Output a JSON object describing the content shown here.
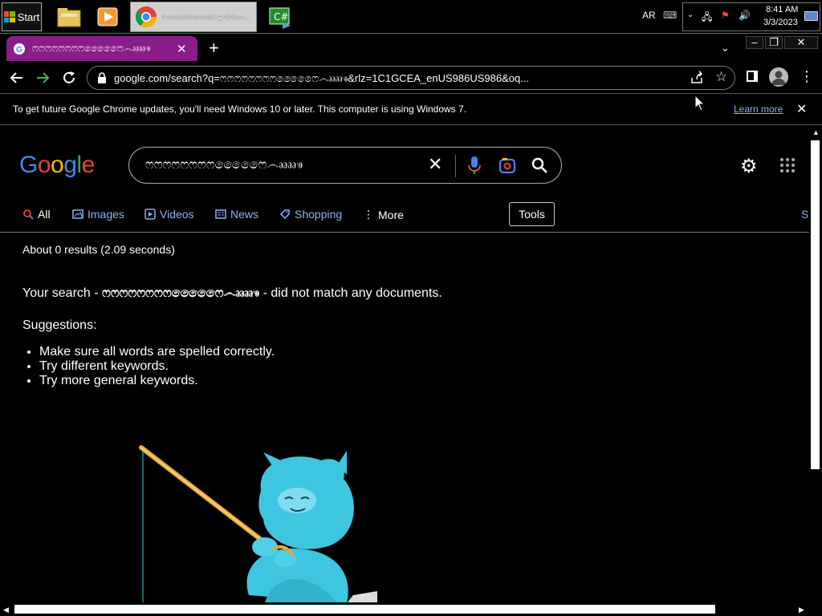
{
  "taskbar": {
    "start_label": "Start",
    "chrome_task_label": "ශෞෂ෧ෂෙෞෂ෧ළෞෂෙෞ...",
    "csharp_label": "C#",
    "language": "AR",
    "clock_time": "8:41 AM",
    "clock_date": "3/3/2023"
  },
  "browser": {
    "tab_title": "ෆෆෆෆෆෆෆෆෆෙෙෛෙ෴ෲෲෳ",
    "new_tab_label": "+",
    "url": "google.com/search?q=ෆෆෆෆෆෆෆෆෆෙෙෛෙ෴ෲෲෳ&rlz=1C1GCEA_enUS986US986&oq...",
    "infobar_text": "To get future Google Chrome updates, you'll need Windows 10 or later. This computer is using Windows 7.",
    "infobar_link": "Learn more"
  },
  "google": {
    "logo": "Google",
    "query": "ෆෆෆෆෆෆෆෆෆෙෙෛෙ෴ෲෲෳ",
    "tabs": [
      {
        "label": "All",
        "icon": "search-icon"
      },
      {
        "label": "Images",
        "icon": "image-icon"
      },
      {
        "label": "Videos",
        "icon": "video-icon"
      },
      {
        "label": "News",
        "icon": "news-icon"
      },
      {
        "label": "Shopping",
        "icon": "tag-icon"
      },
      {
        "label": "More",
        "icon": "more-vert-icon"
      }
    ],
    "tools_label": "Tools",
    "result_stats": "About 0 results (2.09 seconds)",
    "no_match_prefix": "Your search - ",
    "no_match_query": "ෆෆෆෆෆෆෆෆෆෙෙෛෙ෴ෲෲෳ",
    "no_match_suffix": " - did not match any documents.",
    "suggestions_heading": "Suggestions:",
    "suggestions": [
      "Make sure all words are spelled correctly.",
      "Try different keywords.",
      "Try more general keywords."
    ],
    "clipped_tab_letter": "S"
  },
  "colors": {
    "tab_bg": "#8a1d8a",
    "link": "#8ab4f8",
    "google_blue": "#4285f4",
    "google_red": "#ea4335",
    "google_yellow": "#fbbc05",
    "google_green": "#34a853",
    "mascot": "#3ec6e0"
  }
}
